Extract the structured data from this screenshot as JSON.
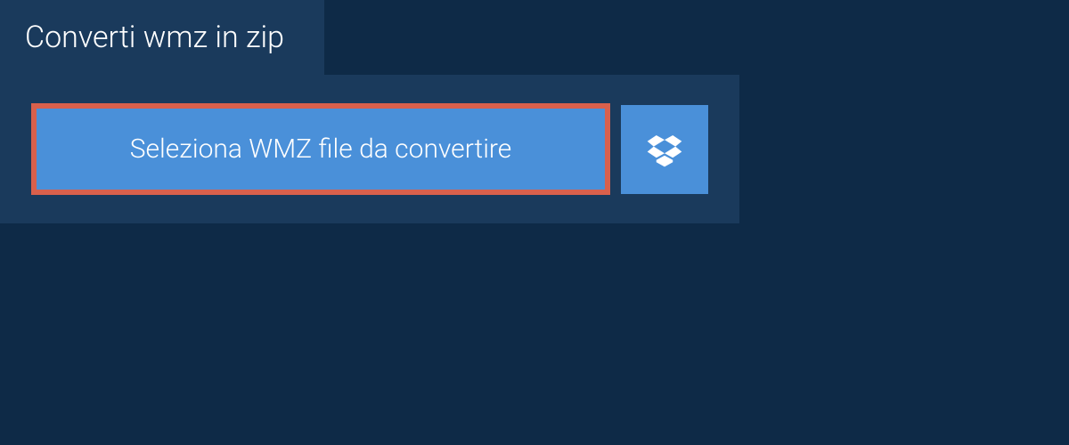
{
  "tab": {
    "title": "Converti wmz in zip"
  },
  "main": {
    "select_button_label": "Seleziona WMZ file da convertire"
  }
}
